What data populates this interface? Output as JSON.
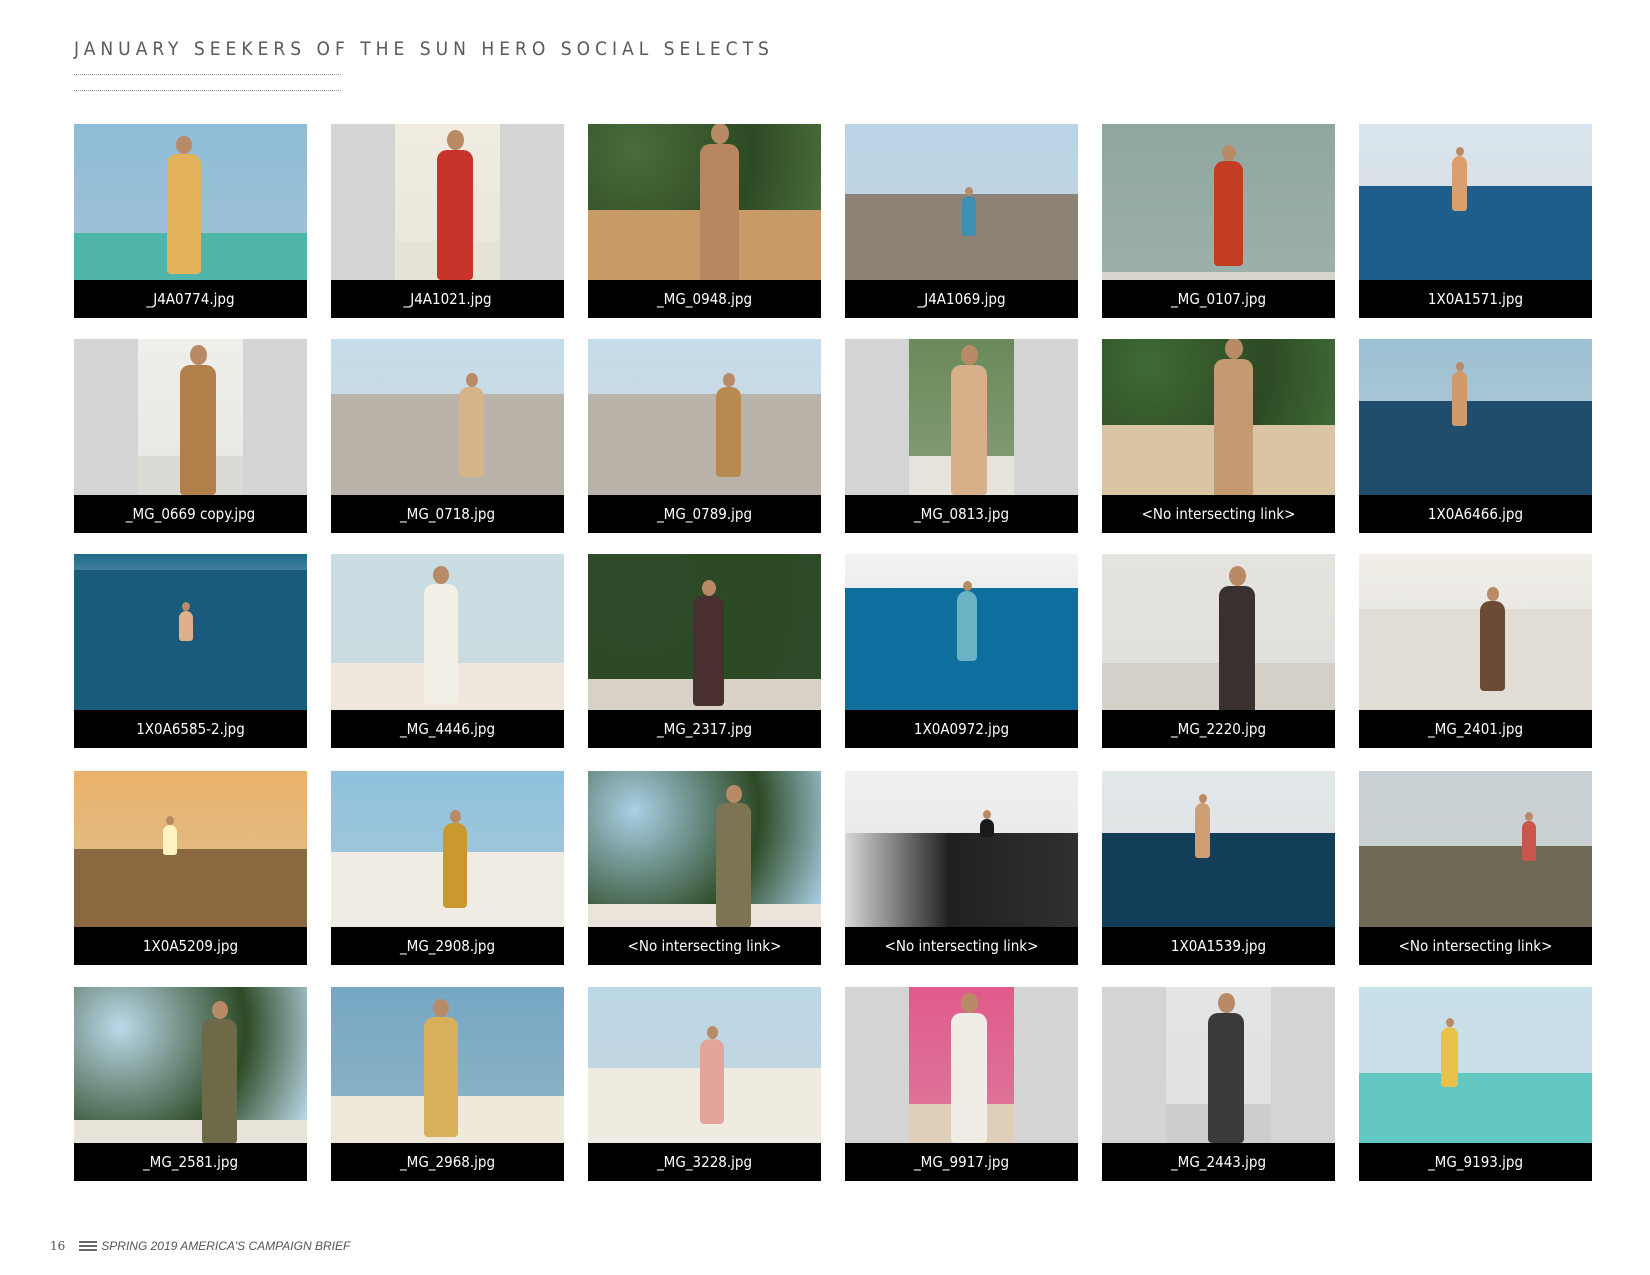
{
  "page": {
    "title": "JANUARY SEEKERS OF THE SUN HERO SOCIAL SELECTS",
    "page_number": "16",
    "footer_text": "SPRING 2019 AMERICA'S CAMPAIGN BRIEF",
    "brand_icon": "billabong-logo-icon"
  },
  "tiles": [
    {
      "caption": "_J4A0774.jpg",
      "scene": "beach-dress",
      "colors": {
        "sky": "#8fbcd8",
        "ground": "#4fb5a8",
        "fig": "#e4b25a"
      }
    },
    {
      "caption": "_J4A1021.jpg",
      "scene": "portrait-red-dress",
      "colors": {
        "sky": "#f1ece0",
        "ground": "#e7e2d6",
        "fig": "#c8332a"
      }
    },
    {
      "caption": "_MG_0948.jpg",
      "scene": "closeup-palm",
      "colors": {
        "sky": "#4a6d3a",
        "ground": "#c79a66",
        "fig": "#b88660"
      }
    },
    {
      "caption": "_J4A1069.jpg",
      "scene": "street",
      "colors": {
        "sky": "#b9d4e6",
        "ground": "#8d8275",
        "fig": "#3f8fb5"
      }
    },
    {
      "caption": "_MG_0107.jpg",
      "scene": "wall-red-dress",
      "colors": {
        "sky": "#8fa7a0",
        "ground": "#d8d4ce",
        "fig": "#c33d24"
      }
    },
    {
      "caption": "1X0A1571.jpg",
      "scene": "surf-water",
      "colors": {
        "sky": "#d9e4ec",
        "ground": "#1d5f8a",
        "fig": "#d9a06e"
      }
    },
    {
      "caption": "_MG_0669 copy.jpg",
      "scene": "portrait-stripes",
      "colors": {
        "sky": "#efeeea",
        "ground": "#dcdad4",
        "fig": "#b07f4a"
      }
    },
    {
      "caption": "_MG_0718.jpg",
      "scene": "white-house",
      "colors": {
        "sky": "#c5dcea",
        "ground": "#b9b3aa",
        "fig": "#d6b48a"
      }
    },
    {
      "caption": "_MG_0789.jpg",
      "scene": "white-house",
      "colors": {
        "sky": "#c5dcea",
        "ground": "#b9b3aa",
        "fig": "#b98a4f"
      }
    },
    {
      "caption": "_MG_0813.jpg",
      "scene": "portrait-palm",
      "colors": {
        "sky": "#6a8a5a",
        "ground": "#e6e3dd",
        "fig": "#d7b08a"
      }
    },
    {
      "caption": "<No intersecting link>",
      "scene": "closeup-palm",
      "colors": {
        "sky": "#3f6a35",
        "ground": "#d9c4a4",
        "fig": "#c49a70"
      }
    },
    {
      "caption": "1X0A6466.jpg",
      "scene": "surf-water",
      "colors": {
        "sky": "#9cc1d4",
        "ground": "#1f4d6b",
        "fig": "#d19a6a"
      }
    },
    {
      "caption": "1X0A6585-2.jpg",
      "scene": "ocean-swim",
      "colors": {
        "sky": "#1e6a8c",
        "ground": "#1a5a7a",
        "fig": "#e0b08a"
      }
    },
    {
      "caption": "_MG_4446.jpg",
      "scene": "beach-dress",
      "colors": {
        "sky": "#c9dde3",
        "ground": "#efe7db",
        "fig": "#f2efe6"
      }
    },
    {
      "caption": "_MG_2317.jpg",
      "scene": "garden",
      "colors": {
        "sky": "#2f4a2a",
        "ground": "#d8d2c6",
        "fig": "#4a2f30"
      }
    },
    {
      "caption": "1X0A0972.jpg",
      "scene": "underwater",
      "colors": {
        "sky": "#f2f4f4",
        "ground": "#0e6f9f",
        "fig": "#6ab3c4"
      }
    },
    {
      "caption": "_MG_2220.jpg",
      "scene": "stairs",
      "colors": {
        "sky": "#e5e3de",
        "ground": "#d4d0c8",
        "fig": "#3a3030"
      }
    },
    {
      "caption": "_MG_2401.jpg",
      "scene": "sand-chairs",
      "colors": {
        "sky": "#f1eee8",
        "ground": "#e2ddd4",
        "fig": "#6b4b35"
      }
    },
    {
      "caption": "1X0A5209.jpg",
      "scene": "sunset",
      "colors": {
        "sky": "#e8b26b",
        "ground": "#8a6840",
        "fig": "#fff3c2"
      }
    },
    {
      "caption": "_MG_2908.jpg",
      "scene": "beach-wide",
      "colors": {
        "sky": "#8fc2dd",
        "ground": "#efece4",
        "fig": "#c9992f"
      }
    },
    {
      "caption": "<No intersecting link>",
      "scene": "palm-bikini",
      "colors": {
        "sky": "#a9d0e6",
        "ground": "#eae4da",
        "fig": "#7d7552"
      }
    },
    {
      "caption": "<No intersecting link>",
      "scene": "wave-bw",
      "colors": {
        "sky": "#f0f0f0",
        "ground": "#9a9a9a",
        "fig": "#1a1a1a"
      }
    },
    {
      "caption": "1X0A1539.jpg",
      "scene": "surf-water",
      "colors": {
        "sky": "#e2e8ea",
        "ground": "#123e57",
        "fig": "#cf9f73"
      }
    },
    {
      "caption": "<No intersecting link>",
      "scene": "surf-dusk",
      "colors": {
        "sky": "#c8d0d3",
        "ground": "#6e6a55",
        "fig": "#c6574a"
      }
    },
    {
      "caption": "_MG_2581.jpg",
      "scene": "palm-bikini",
      "colors": {
        "sky": "#bcd9ea",
        "ground": "#e8e3d8",
        "fig": "#6e6a48"
      }
    },
    {
      "caption": "_MG_2968.jpg",
      "scene": "beach-dress",
      "colors": {
        "sky": "#76a7c3",
        "ground": "#efe9dc",
        "fig": "#d8b05c"
      }
    },
    {
      "caption": "_MG_3228.jpg",
      "scene": "beach-wide",
      "colors": {
        "sky": "#bcd7e6",
        "ground": "#f0ebe1",
        "fig": "#e2a49b"
      }
    },
    {
      "caption": "_MG_9917.jpg",
      "scene": "portrait-colorful",
      "colors": {
        "sky": "#e05a8b",
        "ground": "#e0cfb8",
        "fig": "#f0ede7"
      }
    },
    {
      "caption": "_MG_2443.jpg",
      "scene": "portrait-chair",
      "colors": {
        "sky": "#e4e4e4",
        "ground": "#cdcdcd",
        "fig": "#3a3a3a"
      }
    },
    {
      "caption": "_MG_9193.jpg",
      "scene": "kayak",
      "colors": {
        "sky": "#c7e0ea",
        "ground": "#63c7c2",
        "fig": "#e8c04a"
      }
    }
  ]
}
